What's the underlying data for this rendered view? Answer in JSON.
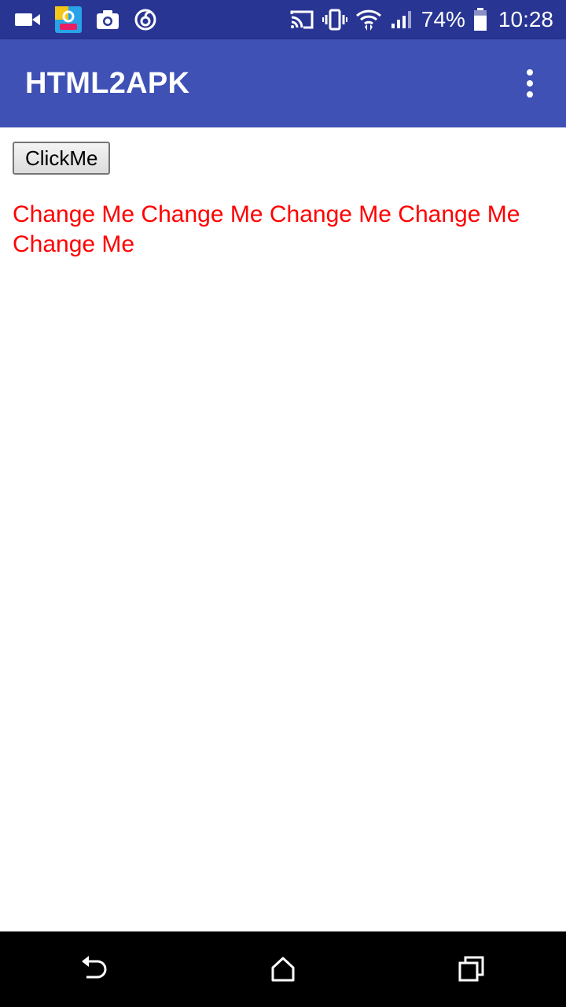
{
  "status_bar": {
    "left_icons": [
      "video-camera-icon",
      "gallery-app-icon",
      "camera-icon",
      "music-app-icon"
    ],
    "right_icons": [
      "cast-icon",
      "vibrate-icon",
      "wifi-icon",
      "signal-icon",
      "battery-icon"
    ],
    "battery_percent": "74%",
    "time": "10:28",
    "battery_level": 0.74
  },
  "app_bar": {
    "title": "HTML2APK",
    "menu_icon": "more-vert-icon"
  },
  "content": {
    "button_label": "ClickMe",
    "change_text": "Change Me Change Me Change Me Change Me Change Me",
    "text_color": "#ff0000"
  },
  "nav_bar": {
    "buttons": [
      "back-icon",
      "home-icon",
      "recents-icon"
    ]
  },
  "colors": {
    "status_bar": "#283593",
    "app_bar": "#3f51b5",
    "nav_bar": "#000000"
  }
}
